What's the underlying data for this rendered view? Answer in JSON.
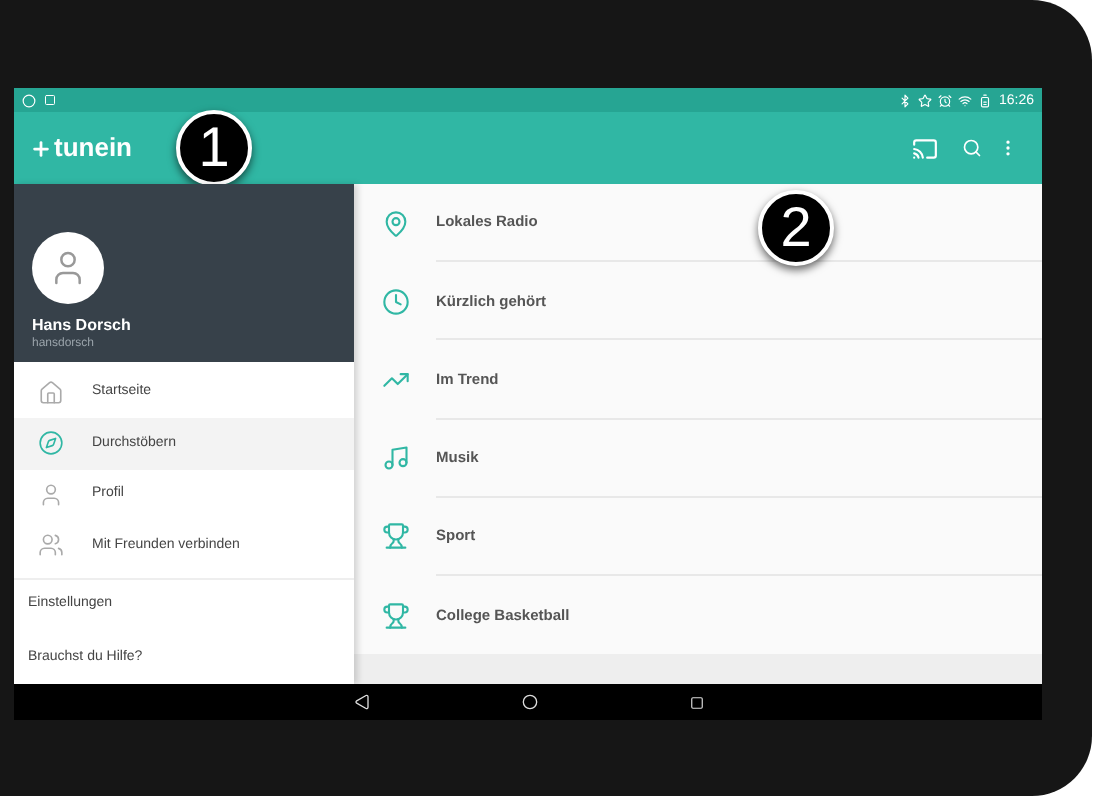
{
  "status_bar": {
    "time": "16:26"
  },
  "toolbar": {
    "logo": "tunein"
  },
  "callouts": [
    "1",
    "2"
  ],
  "profile": {
    "name": "Hans Dorsch",
    "username": "hansdorsch"
  },
  "sidebar": {
    "items": [
      {
        "label": "Startseite",
        "selected": false
      },
      {
        "label": "Durchstöbern",
        "selected": true
      },
      {
        "label": "Profil",
        "selected": false
      },
      {
        "label": "Mit Freunden verbinden",
        "selected": false
      }
    ],
    "links": [
      "Einstellungen",
      "Brauchst du Hilfe?"
    ]
  },
  "categories": [
    {
      "label": "Lokales Radio"
    },
    {
      "label": "Kürzlich gehört"
    },
    {
      "label": "Im Trend"
    },
    {
      "label": "Musik"
    },
    {
      "label": "Sport"
    },
    {
      "label": "College Basketball"
    }
  ]
}
